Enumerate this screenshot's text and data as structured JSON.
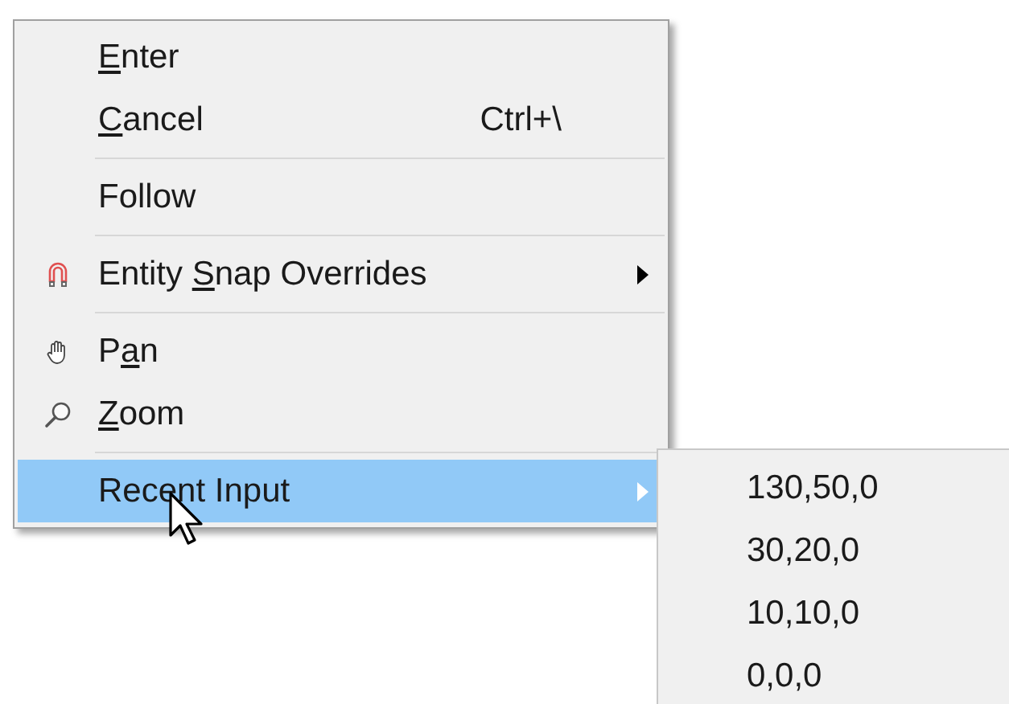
{
  "menu": {
    "items": [
      {
        "kind": "item",
        "label": [
          {
            "text": "E",
            "underline": true
          },
          {
            "text": "nter",
            "underline": false
          }
        ],
        "selected": false,
        "has_submenu": false
      },
      {
        "kind": "item",
        "label": [
          {
            "text": "C",
            "underline": true
          },
          {
            "text": "ancel",
            "underline": false
          }
        ],
        "shortcut": "Ctrl+\\",
        "selected": false,
        "has_submenu": false
      },
      {
        "kind": "separator"
      },
      {
        "kind": "item",
        "label": [
          {
            "text": "Follow",
            "underline": false
          }
        ],
        "selected": false,
        "has_submenu": false
      },
      {
        "kind": "separator"
      },
      {
        "kind": "item",
        "label": [
          {
            "text": "Entity ",
            "underline": false
          },
          {
            "text": "S",
            "underline": true
          },
          {
            "text": "nap Overrides",
            "underline": false
          }
        ],
        "selected": false,
        "has_submenu": true
      },
      {
        "kind": "separator"
      },
      {
        "kind": "item",
        "label": [
          {
            "text": "P",
            "underline": false
          },
          {
            "text": "a",
            "underline": true
          },
          {
            "text": "n",
            "underline": false
          }
        ],
        "selected": false,
        "has_submenu": false
      },
      {
        "kind": "item",
        "label": [
          {
            "text": "Z",
            "underline": true
          },
          {
            "text": "oom",
            "underline": false
          }
        ],
        "selected": false,
        "has_submenu": false
      },
      {
        "kind": "separator"
      },
      {
        "kind": "item",
        "label": [
          {
            "text": "Recent Input",
            "underline": false
          }
        ],
        "selected": true,
        "has_submenu": true
      }
    ]
  },
  "submenu": {
    "items": [
      {
        "label": "130,50,0"
      },
      {
        "label": "30,20,0"
      },
      {
        "label": "10,10,0"
      },
      {
        "label": "0,0,0"
      }
    ]
  }
}
